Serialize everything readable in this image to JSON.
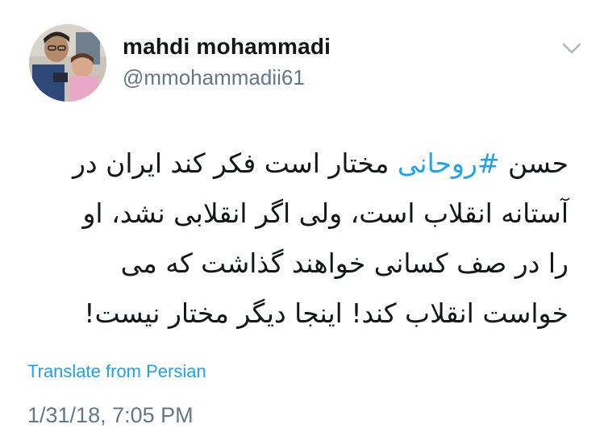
{
  "user": {
    "display_name": "mahdi mohammadi",
    "handle": "@mmohammadii61"
  },
  "icons": {
    "menu": "chevron-down-icon",
    "avatar": "profile-photo"
  },
  "tweet": {
    "line1_start": "حسن ",
    "hashtag": "#روحانی",
    "line1_end": " مختار است فکر کند ایران در",
    "line2": "آستانه انقلاب است، ولی اگر انقلابی نشد، او",
    "line3": "را در صف کسانی خواهند گذاشت که می",
    "line4": "خواست انقلاب کند! اینجا دیگر مختار نیست!"
  },
  "translate_label": "Translate from Persian",
  "timestamp": "1/31/18, 7:05 PM",
  "colors": {
    "link": "#1da1f2",
    "secondary_text": "#657786",
    "primary_text": "#14171a"
  }
}
